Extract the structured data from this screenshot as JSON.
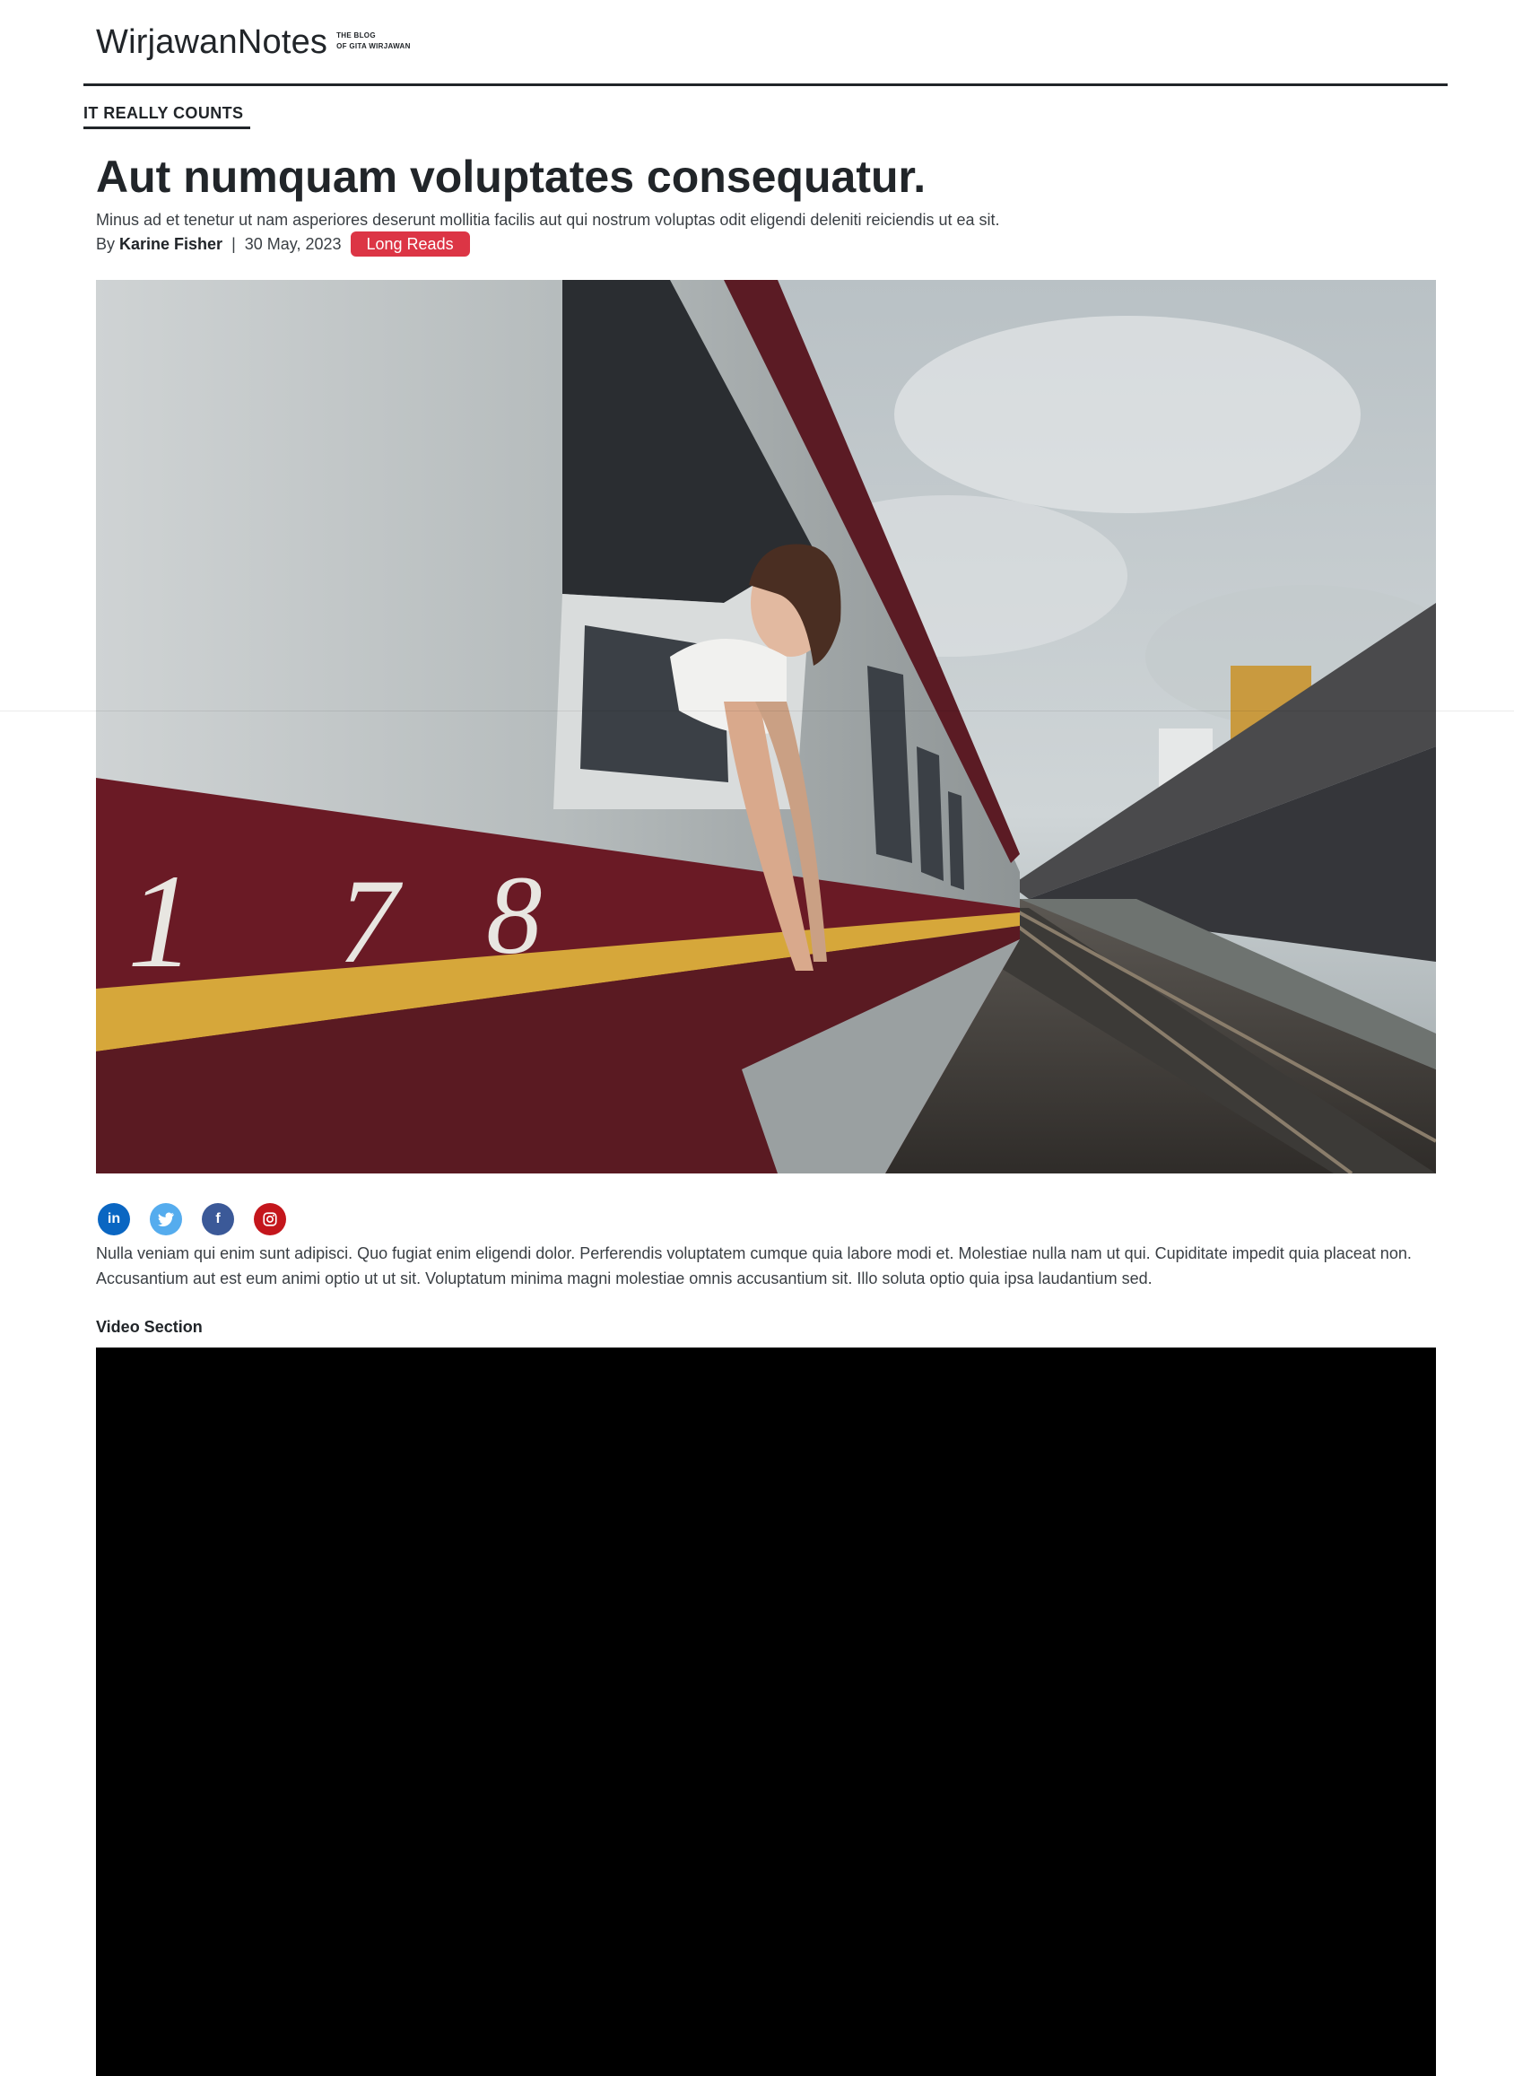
{
  "header": {
    "brand_name": "WirjawanNotes",
    "tagline_line1": "THE BLOG",
    "tagline_line2": "OF GITA WIRJAWAN"
  },
  "article": {
    "category": "IT REALLY COUNTS",
    "title": "Aut numquam voluptates consequatur.",
    "lede": "Minus ad et tenetur ut nam asperiores deserunt mollitia facilis aut qui nostrum voluptas odit eligendi deleniti reiciendis ut ea sit.",
    "byline_prefix": "By",
    "author": "Karine Fisher",
    "separator": "|",
    "date": "30 May, 2023",
    "tag": "Long Reads",
    "body": "Nulla veniam qui enim sunt adipisci. Quo fugiat enim eligendi dolor. Perferendis voluptatem cumque quia labore modi et. Molestiae nulla nam ut qui. Cupiditate impedit quia placeat non. Accusantium aut est eum animi optio ut ut sit. Voluptatum minima magni molestiae omnis accusantium sit. Illo soluta optio quia ipsa laudantium sed.",
    "video_heading": "Video Section"
  },
  "hero_numbers": {
    "digit1": "1",
    "digit2": "7",
    "digit3": "8"
  },
  "social": {
    "linkedin": "in",
    "twitter_icon": "twitter-icon",
    "facebook": "f",
    "instagram_icon": "instagram-icon"
  },
  "colors": {
    "badge": "#dc3545",
    "linkedin": "#0a66c2",
    "twitter": "#55acee",
    "facebook": "#3b5998",
    "instagram": "#c4161c"
  }
}
